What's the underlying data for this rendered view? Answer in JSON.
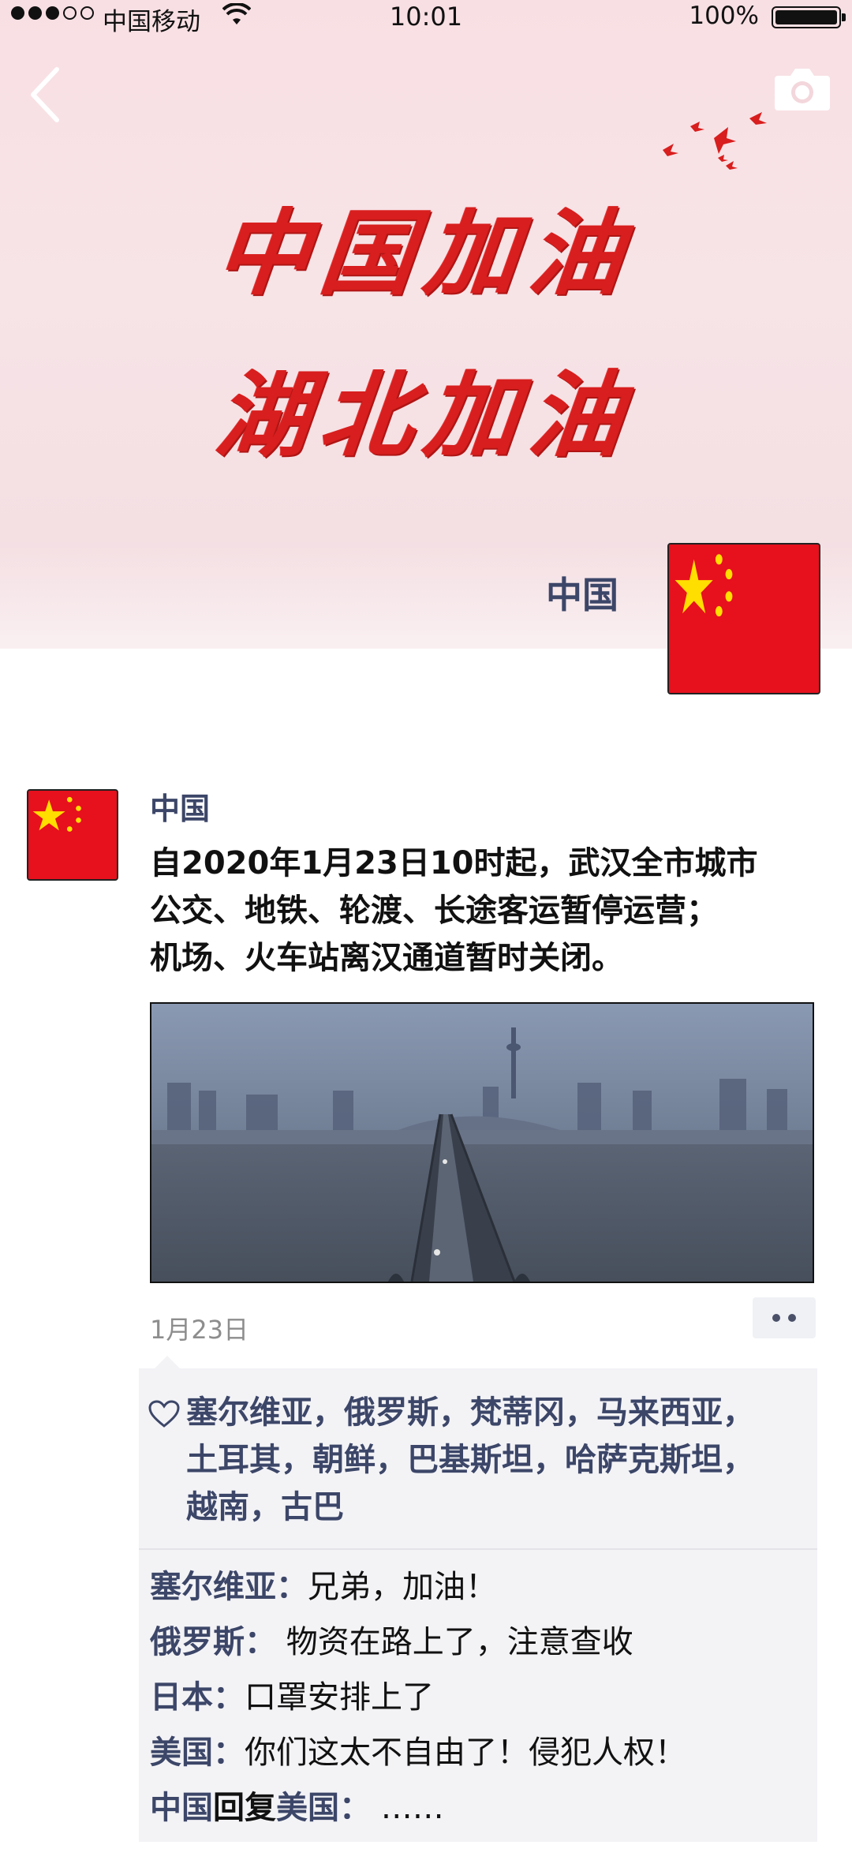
{
  "status_bar": {
    "carrier": "中国移动",
    "time": "10:01",
    "battery": "100%"
  },
  "cover": {
    "slogan_line1": "中国加油",
    "slogan_line2": "湖北加油",
    "profile_name": "中国"
  },
  "post": {
    "author": "中国",
    "text_lines": [
      "自2020年1月23日10时起，武汉全市城市",
      "公交、地铁、轮渡、长途客运暂停运营；",
      "机场、火车站离汉通道暂时关闭。"
    ],
    "date": "1月23日"
  },
  "likes": {
    "lines": [
      "塞尔维亚，俄罗斯，梵蒂冈，马来西亚，",
      "土耳其，朝鲜，巴基斯坦，哈萨克斯坦，",
      "越南，古巴"
    ]
  },
  "comments": [
    {
      "author": "塞尔维亚",
      "text": "兄弟，加油！"
    },
    {
      "author": "俄罗斯",
      "text": " 物资在路上了，注意查收"
    },
    {
      "author": "日本",
      "text": "口罩安排上了"
    },
    {
      "author": "美国",
      "text": "你们这太不自由了！侵犯人权！"
    },
    {
      "author": "中国",
      "reply_word": "回复",
      "reply_to": "美国",
      "text": " ……"
    }
  ],
  "colon": "：",
  "colors": {
    "name_blue": "#3c4668",
    "slogan_red": "#d81e1e",
    "flag_red": "#e7101d",
    "flag_yellow": "#ffde00"
  },
  "icons": [
    "back-chevron-icon",
    "camera-icon",
    "heart-icon",
    "more-dots-icon"
  ]
}
